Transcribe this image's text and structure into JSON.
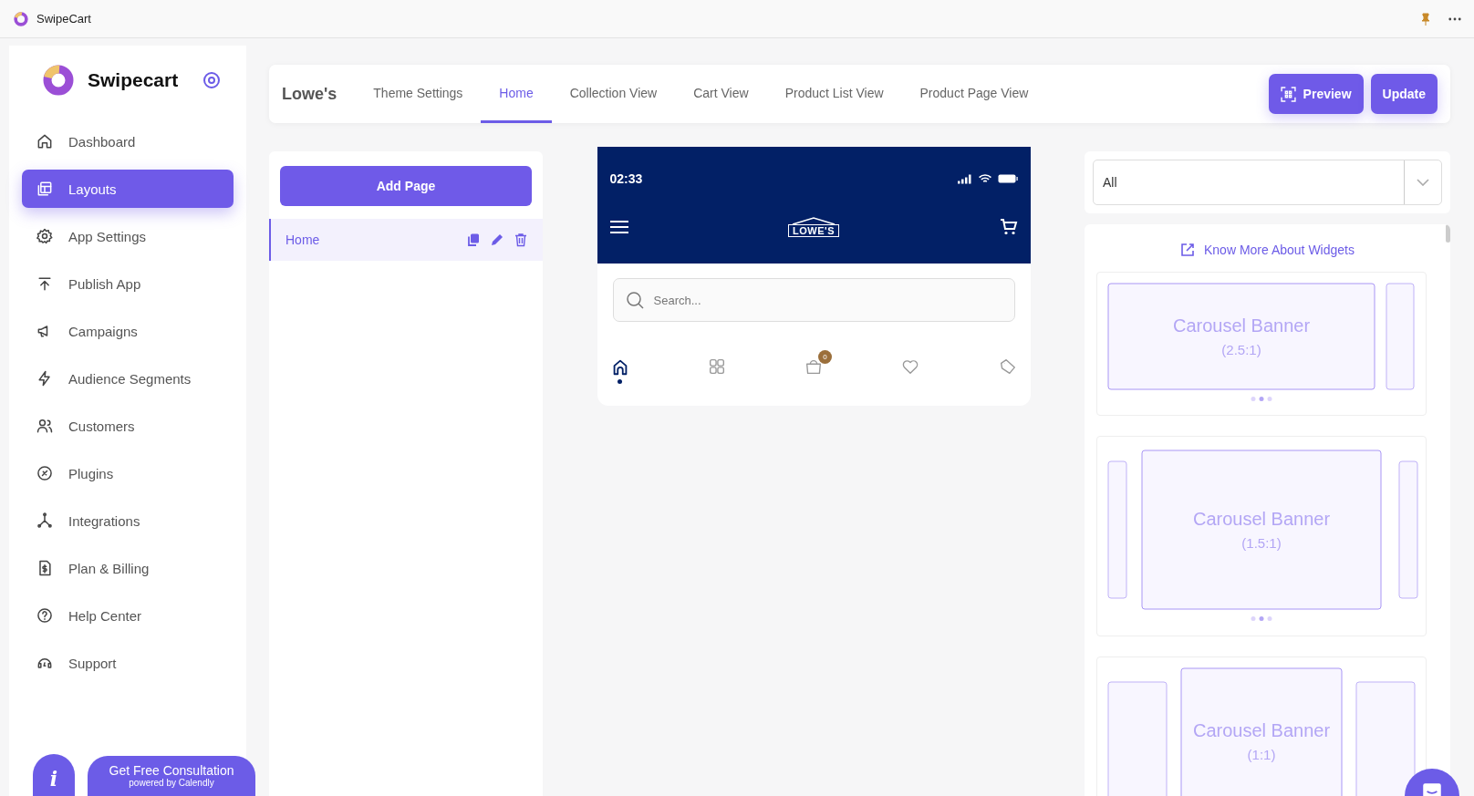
{
  "window": {
    "title": "SwipeCart"
  },
  "sidebar": {
    "brand": "Swipecart",
    "items": [
      {
        "label": "Dashboard",
        "kind": "home",
        "selected": false
      },
      {
        "label": "Layouts",
        "kind": "layouts",
        "selected": true
      },
      {
        "label": "App Settings",
        "kind": "gear",
        "selected": false
      },
      {
        "label": "Publish App",
        "kind": "publish",
        "selected": false
      },
      {
        "label": "Campaigns",
        "kind": "megaphone",
        "selected": false
      },
      {
        "label": "Audience Segments",
        "kind": "bolt",
        "selected": false
      },
      {
        "label": "Customers",
        "kind": "users",
        "selected": false
      },
      {
        "label": "Plugins",
        "kind": "plug",
        "selected": false
      },
      {
        "label": "Integrations",
        "kind": "nodes",
        "selected": false
      },
      {
        "label": "Plan & Billing",
        "kind": "bill",
        "selected": false
      },
      {
        "label": "Help Center",
        "kind": "help",
        "selected": false
      },
      {
        "label": "Support",
        "kind": "headset",
        "selected": false
      }
    ]
  },
  "info_button": {
    "label": "i"
  },
  "consultation": {
    "title": "Get Free Consultation",
    "subtitle": "powered by Calendly"
  },
  "topbar": {
    "store": "Lowe's",
    "tabs": [
      {
        "label": "Theme Settings",
        "selected": false
      },
      {
        "label": "Home",
        "selected": true
      },
      {
        "label": "Collection View",
        "selected": false
      },
      {
        "label": "Cart View",
        "selected": false
      },
      {
        "label": "Product List View",
        "selected": false
      },
      {
        "label": "Product Page View",
        "selected": false
      }
    ],
    "preview_button": "Preview",
    "update_button": "Update"
  },
  "pages": {
    "add_button": "Add Page",
    "items": [
      {
        "label": "Home",
        "selected": true
      }
    ]
  },
  "phone": {
    "time": "02:33",
    "logo": "LOWE'S",
    "search_placeholder": "Search...",
    "cart_count": "0",
    "nav": [
      {
        "kind": "home",
        "selected": true
      },
      {
        "kind": "grid",
        "selected": false
      },
      {
        "kind": "bag",
        "selected": false
      },
      {
        "kind": "heart",
        "selected": false
      },
      {
        "kind": "tag",
        "selected": false
      }
    ]
  },
  "widgets": {
    "filter": "All",
    "link": "Know More About Widgets",
    "items": [
      {
        "kind": "wide",
        "title": "Carousel Banner",
        "ratio": "(2.5:1)"
      },
      {
        "kind": "medium",
        "title": "Carousel Banner",
        "ratio": "(1.5:1)"
      },
      {
        "kind": "square",
        "title": "Carousel Banner",
        "ratio": "(1:1)"
      }
    ]
  }
}
